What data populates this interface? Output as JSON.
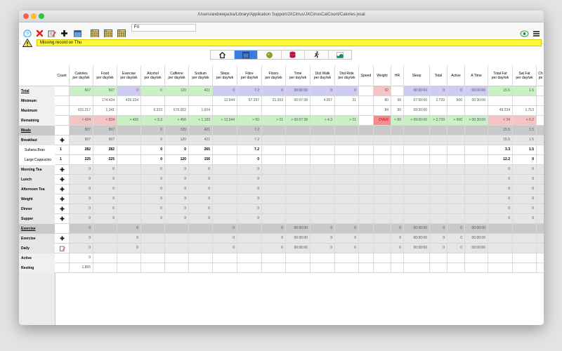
{
  "window": {
    "title": "/Users/andrewjacka/Library/Application Support/JXCirrus/JXCirrusCalCount/Calories.jxcal"
  },
  "toolbar": {
    "buttons": [
      "help-icon",
      "delete-icon",
      "edit-icon",
      "add-icon",
      "calendar-icon",
      "week-prev-icon",
      "week-icon",
      "week-next-icon"
    ],
    "date_value": "Fri",
    "right_icons": [
      "sync-icon",
      "menu-icon"
    ]
  },
  "warning": {
    "message": "Missing record on Thu"
  },
  "nav_tabs": [
    "home",
    "calendar",
    "food",
    "database",
    "exercise",
    "chart"
  ],
  "grid": {
    "count_header": "Count",
    "columns": [
      {
        "l1": "Calories",
        "l2": "per day/wk"
      },
      {
        "l1": "Food",
        "l2": "per day/wk"
      },
      {
        "l1": "Exercise",
        "l2": "per day/wk"
      },
      {
        "l1": "Alcohol",
        "l2": "per day/wk"
      },
      {
        "l1": "Caffeine",
        "l2": "per day/wk"
      },
      {
        "l1": "Sodium",
        "l2": "per day/wk"
      },
      {
        "l1": "Steps",
        "l2": "per day/wk"
      },
      {
        "l1": "Fibre",
        "l2": "per day/wk"
      },
      {
        "l1": "Floors",
        "l2": "per day/wk"
      },
      {
        "l1": "Time",
        "l2": "per day/wk"
      },
      {
        "l1": "Dist Walk",
        "l2": "per day/wk"
      },
      {
        "l1": "Dist Ride",
        "l2": "per day/wk"
      },
      {
        "l1": "Speed",
        "l2": ""
      },
      {
        "l1": "Weight",
        "l2": ""
      },
      {
        "l1": "HR",
        "l2": ""
      },
      {
        "l1": "Sleep",
        "l2": ""
      },
      {
        "l1": "Total",
        "l2": ""
      },
      {
        "l1": "Active",
        "l2": ""
      },
      {
        "l1": "A Time",
        "l2": ""
      },
      {
        "l1": "Total Fat",
        "l2": "per day/wk"
      },
      {
        "l1": "Sat Fat",
        "l2": "per day/wk"
      },
      {
        "l1": "Ch",
        "l2": "pe"
      }
    ],
    "rows": [
      {
        "label": "Total",
        "style": "under",
        "bg": "#fff",
        "plus": false,
        "count": "",
        "cells": [
          "507",
          "507",
          "0",
          "0",
          "120",
          "421",
          "0",
          "7.2",
          "0",
          "00:00:00",
          "0",
          "0",
          "",
          "92",
          "",
          "00:00:00",
          "0",
          "0",
          "00:00:00",
          "15.5",
          "1.5",
          ""
        ],
        "cellbg": [
          "#c8f1c4",
          "#c8f1c4",
          "#cdccf3",
          "#c8f1c4",
          "#c8f1c4",
          "#c8f1c4",
          "#cdccf3",
          "#cdccf3",
          "#cdccf3",
          "#cdccf3",
          "#cdccf3",
          "#cdccf3",
          "#fff",
          "#f7c4c4",
          "#fff",
          "#cdccf3",
          "#cdccf3",
          "#cdccf3",
          "#cdccf3",
          "#c8f1c4",
          "#c8f1c4",
          "#fff"
        ]
      },
      {
        "label": "Minimum",
        "style": "",
        "bg": "#fff",
        "plus": false,
        "count": "",
        "cells": [
          "",
          "174.434",
          "426.334",
          "",
          "",
          "",
          "12,644",
          "57.297",
          "21.333",
          "00:07:38",
          "4.267",
          "21",
          "",
          "80",
          "60",
          "07:00:00",
          "2,739",
          "500",
          "00:30:00",
          "",
          "",
          ""
        ]
      },
      {
        "label": "Maximum",
        "style": "",
        "bg": "#fff",
        "plus": false,
        "count": "",
        "cells": [
          "931.217",
          "1,341",
          "",
          "9.333",
          "576.002",
          "1,604",
          "",
          "",
          "",
          "",
          "",
          "",
          "",
          "84",
          "90",
          "09:00:00",
          "",
          "",
          "",
          "49.234",
          "1,713",
          ""
        ]
      },
      {
        "label": "Remaining",
        "style": "",
        "bg": "#fff",
        "plus": false,
        "count": "",
        "cells": [
          "< 424",
          "< 834",
          "> 426",
          "< 9.3",
          "< 456",
          "< 1,183",
          "> 12,644",
          "> 50",
          "> 21",
          "> 00:07:38",
          "> 4.3",
          "> 21",
          "",
          "OVER",
          "< 80",
          "< 09:00:00",
          "> 2,739",
          "> 500",
          "> 00:30:00",
          "< 34",
          "< 0.2",
          ""
        ],
        "cellbg": [
          "#f7c4c4",
          "#f7c4c4",
          "#c8f1c4",
          "#c8f1c4",
          "#c8f1c4",
          "#c8f1c4",
          "#c8f1c4",
          "#c8f1c4",
          "#c8f1c4",
          "#c8f1c4",
          "#c8f1c4",
          "#c8f1c4",
          "#fff",
          "#f58c8c",
          "#c8f1c4",
          "#c8f1c4",
          "#c8f1c4",
          "#c8f1c4",
          "#c8f1c4",
          "#f7c4c4",
          "#f7c4c4",
          "#fff"
        ]
      },
      {
        "label": "Meals",
        "style": "under",
        "bg": "#c9c9c9",
        "plus": false,
        "count": "",
        "cells": [
          "507",
          "507",
          "",
          "0",
          "120",
          "421",
          "",
          "7.2",
          "",
          "",
          "",
          "",
          "",
          "",
          "",
          "",
          "",
          "",
          "",
          "15.5",
          "1.5",
          ""
        ]
      },
      {
        "label": "Breakfast",
        "style": "",
        "bg": "#e6e6e6",
        "plus": true,
        "count": "",
        "cells": [
          "507",
          "507",
          "",
          "0",
          "120",
          "421",
          "",
          "7.2",
          "",
          "",
          "",
          "",
          "",
          "",
          "",
          "",
          "",
          "",
          "",
          "15.5",
          "1.5",
          ""
        ]
      },
      {
        "label": "Sultana Bran",
        "style": "sub",
        "bg": "#fff",
        "plus": false,
        "count": "1",
        "bold": true,
        "cells": [
          "282",
          "282",
          "",
          "0",
          "0",
          "265",
          "",
          "7.2",
          "",
          "",
          "",
          "",
          "",
          "",
          "",
          "",
          "",
          "",
          "",
          "3.3",
          "1.5",
          ""
        ]
      },
      {
        "label": "Large Cappucino",
        "style": "sub",
        "bg": "#fff",
        "plus": false,
        "count": "1",
        "bold": true,
        "cells": [
          "225",
          "225",
          "",
          "0",
          "120",
          "156",
          "",
          "0",
          "",
          "",
          "",
          "",
          "",
          "",
          "",
          "",
          "",
          "",
          "",
          "12.2",
          "0",
          ""
        ]
      },
      {
        "label": "Morning Tea",
        "style": "",
        "bg": "#e6e6e6",
        "plus": true,
        "count": "",
        "cells": [
          "0",
          "0",
          "",
          "0",
          "0",
          "0",
          "",
          "0",
          "",
          "",
          "",
          "",
          "",
          "",
          "",
          "",
          "",
          "",
          "",
          "0",
          "0",
          ""
        ]
      },
      {
        "label": "Lunch",
        "style": "",
        "bg": "#e6e6e6",
        "plus": true,
        "count": "",
        "cells": [
          "0",
          "0",
          "",
          "0",
          "0",
          "0",
          "",
          "0",
          "",
          "",
          "",
          "",
          "",
          "",
          "",
          "",
          "",
          "",
          "",
          "0",
          "0",
          ""
        ]
      },
      {
        "label": "Afternoon Tea",
        "style": "",
        "bg": "#e6e6e6",
        "plus": true,
        "count": "",
        "cells": [
          "0",
          "0",
          "",
          "0",
          "0",
          "0",
          "",
          "0",
          "",
          "",
          "",
          "",
          "",
          "",
          "",
          "",
          "",
          "",
          "",
          "0",
          "0",
          ""
        ]
      },
      {
        "label": "Weight",
        "style": "",
        "bg": "#e6e6e6",
        "plus": true,
        "count": "",
        "cells": [
          "0",
          "0",
          "",
          "0",
          "0",
          "0",
          "",
          "0",
          "",
          "",
          "",
          "",
          "",
          "",
          "",
          "",
          "",
          "",
          "",
          "0",
          "0",
          ""
        ]
      },
      {
        "label": "Dinner",
        "style": "",
        "bg": "#e6e6e6",
        "plus": true,
        "count": "",
        "cells": [
          "0",
          "0",
          "",
          "0",
          "0",
          "0",
          "",
          "0",
          "",
          "",
          "",
          "",
          "",
          "",
          "",
          "",
          "",
          "",
          "",
          "0",
          "0",
          ""
        ]
      },
      {
        "label": "Supper",
        "style": "",
        "bg": "#e6e6e6",
        "plus": true,
        "count": "",
        "cells": [
          "0",
          "0",
          "",
          "0",
          "0",
          "0",
          "",
          "0",
          "",
          "",
          "",
          "",
          "",
          "",
          "",
          "",
          "",
          "",
          "",
          "0",
          "0",
          ""
        ]
      },
      {
        "label": "Exercise",
        "style": "under",
        "bg": "#c9c9c9",
        "plus": false,
        "count": "",
        "cells": [
          "0",
          "",
          "0",
          "",
          "",
          "",
          "0",
          "",
          "0",
          "00:00:00",
          "0",
          "0",
          "",
          "",
          "0",
          "00:00:00",
          "0",
          "0",
          "00:00:00",
          "",
          "",
          ""
        ]
      },
      {
        "label": "Exercise",
        "style": "",
        "bg": "#e6e6e6",
        "plus": true,
        "count": "",
        "cells": [
          "0",
          "",
          "0",
          "",
          "",
          "",
          "0",
          "",
          "0",
          "00:00:00",
          "0",
          "0",
          "",
          "",
          "0",
          "00:00:00",
          "0",
          "0",
          "00:00:00",
          "",
          "",
          ""
        ]
      },
      {
        "label": "Daily",
        "style": "",
        "bg": "#e6e6e6",
        "plus": false,
        "edit": true,
        "count": "",
        "cells": [
          "0",
          "",
          "0",
          "",
          "",
          "",
          "0",
          "",
          "0",
          "00:00:00",
          "0",
          "0",
          "",
          "",
          "0",
          "00:00:00",
          "0",
          "0",
          "00:00:00",
          "",
          "",
          ""
        ]
      },
      {
        "label": "Active",
        "style": "",
        "bg": "#fff",
        "plus": false,
        "count": "",
        "cells": [
          "0",
          "",
          "",
          "",
          "",
          "",
          "",
          "",
          "",
          "",
          "",
          "",
          "",
          "",
          "",
          "",
          "",
          "",
          "",
          "",
          "",
          ""
        ]
      },
      {
        "label": "Resting",
        "style": "",
        "bg": "#fff",
        "plus": false,
        "count": "",
        "cells": [
          "1,865",
          "",
          "",
          "",
          "",
          "",
          "",
          "",
          "",
          "",
          "",
          "",
          "",
          "",
          "",
          "",
          "",
          "",
          "",
          "",
          "",
          ""
        ]
      }
    ]
  }
}
